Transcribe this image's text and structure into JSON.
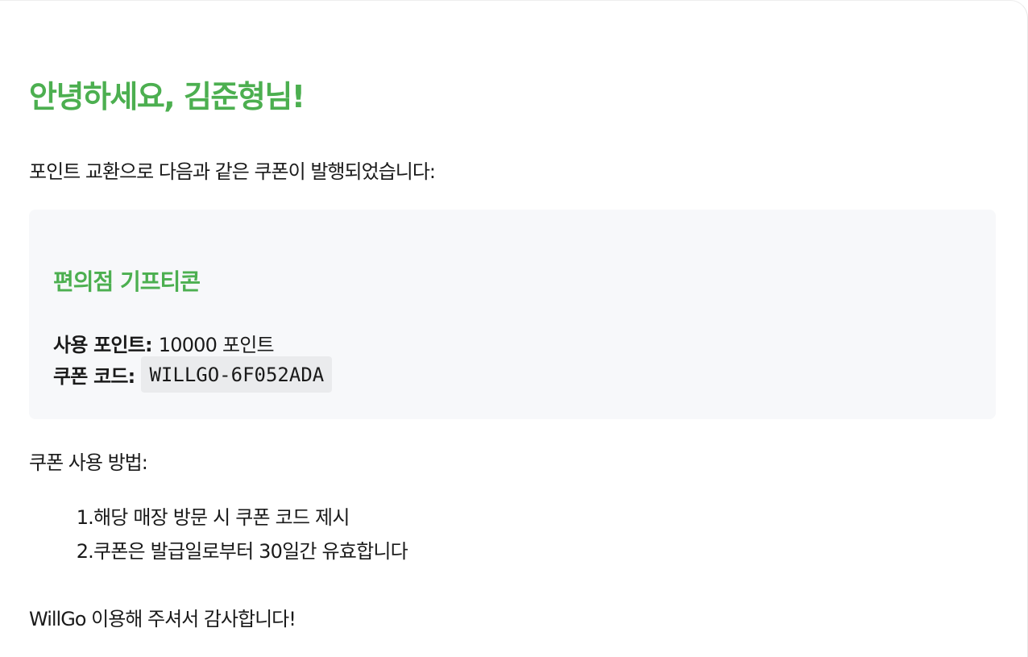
{
  "greeting": "안녕하세요, 김준형님!",
  "intro": "포인트 교환으로 다음과 같은 쿠폰이 발행되었습니다:",
  "coupon": {
    "title": "편의점 기프티콘",
    "points_label": "사용 포인트:",
    "points_value": "10000 포인트",
    "code_label": "쿠폰 코드:",
    "code_value": "WILLGO-6F052ADA"
  },
  "usage": {
    "heading": "쿠폰 사용 방법:",
    "items": [
      {
        "num": "1.",
        "text": "해당 매장 방문 시 쿠폰 코드 제시"
      },
      {
        "num": "2.",
        "text": "쿠폰은 발급일로부터 30일간 유효합니다"
      }
    ]
  },
  "thanks": "WillGo 이용해 주셔서 감사합니다!",
  "colors": {
    "accent": "#4caf50",
    "box_background": "#f7f8fa",
    "code_background": "#eaebed"
  }
}
